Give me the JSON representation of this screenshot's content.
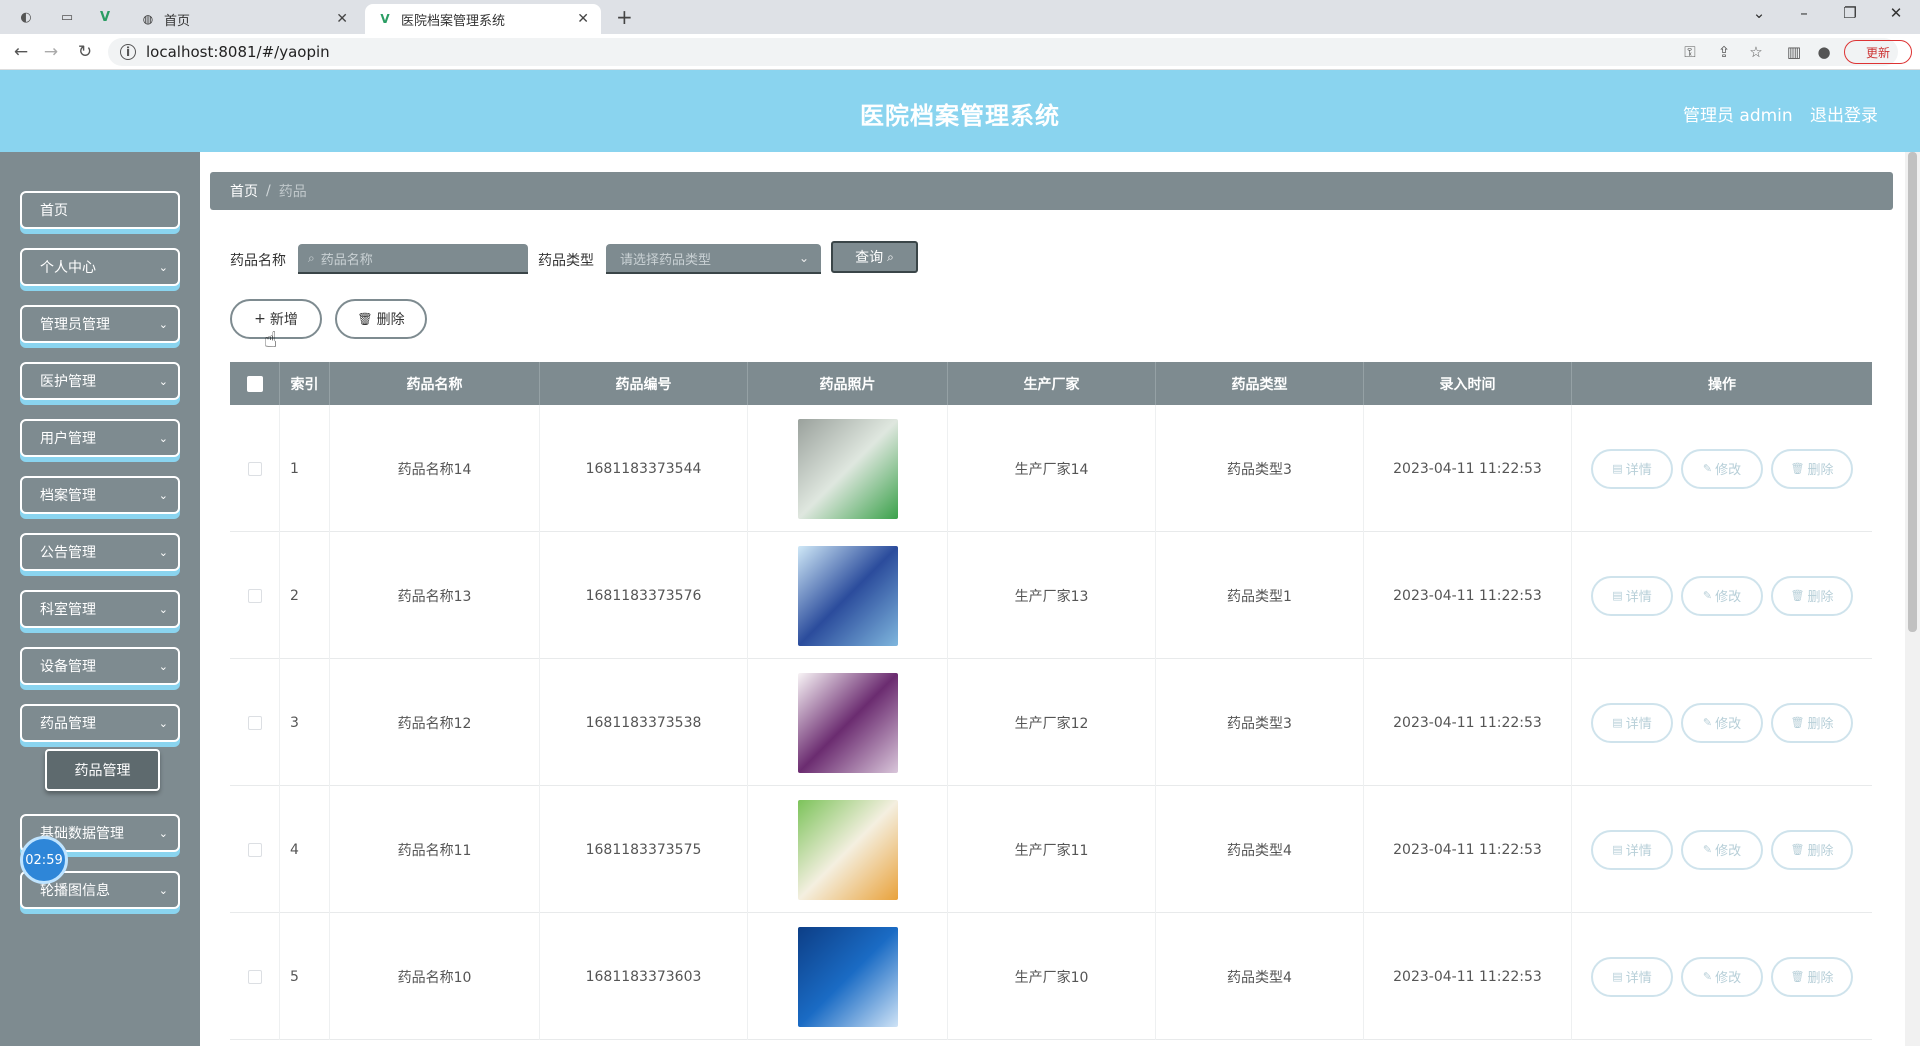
{
  "browser": {
    "tabs": [
      {
        "title": "首页",
        "active": false
      },
      {
        "title": "医院档案管理系统",
        "active": true
      }
    ],
    "url": "localhost:8081/#/yaopin",
    "update_label": "更新"
  },
  "header": {
    "title": "医院档案管理系统",
    "user": "管理员 admin",
    "logout": "退出登录"
  },
  "sidebar": {
    "items": [
      {
        "label": "首页",
        "has_children": false
      },
      {
        "label": "个人中心",
        "has_children": true
      },
      {
        "label": "管理员管理",
        "has_children": true
      },
      {
        "label": "医护管理",
        "has_children": true
      },
      {
        "label": "用户管理",
        "has_children": true
      },
      {
        "label": "档案管理",
        "has_children": true
      },
      {
        "label": "公告管理",
        "has_children": true
      },
      {
        "label": "科室管理",
        "has_children": true
      },
      {
        "label": "设备管理",
        "has_children": true
      },
      {
        "label": "药品管理",
        "has_children": true
      },
      {
        "label": "基础数据管理",
        "has_children": true
      },
      {
        "label": "轮播图信息",
        "has_children": true
      }
    ],
    "active_submenu": "药品管理",
    "clock": "02:59"
  },
  "breadcrumb": {
    "home": "首页",
    "separator": "/",
    "current": "药品"
  },
  "filters": {
    "name_label": "药品名称",
    "name_placeholder": "药品名称",
    "type_label": "药品类型",
    "type_placeholder": "请选择药品类型",
    "query_button": "查询"
  },
  "actions": {
    "add": "新增",
    "delete": "删除"
  },
  "table": {
    "columns": [
      "索引",
      "药品名称",
      "药品编号",
      "药品照片",
      "生产厂家",
      "药品类型",
      "录入时间",
      "操作"
    ],
    "rows": [
      {
        "index": "1",
        "name": "药品名称14",
        "code": "1681183373544",
        "maker": "生产厂家14",
        "type": "药品类型3",
        "time": "2023-04-11 11:22:53",
        "photo_colors": [
          "#9aa19c",
          "#dfe7df",
          "#3aa14a"
        ]
      },
      {
        "index": "2",
        "name": "药品名称13",
        "code": "1681183373576",
        "maker": "生产厂家13",
        "type": "药品类型1",
        "time": "2023-04-11 11:22:53",
        "photo_colors": [
          "#cfe8f7",
          "#2b4c9c",
          "#7fb6dd"
        ]
      },
      {
        "index": "3",
        "name": "药品名称12",
        "code": "1681183373538",
        "maker": "生产厂家12",
        "type": "药品类型3",
        "time": "2023-04-11 11:22:53",
        "photo_colors": [
          "#f8f4f6",
          "#6b2c70",
          "#d9c6da"
        ]
      },
      {
        "index": "4",
        "name": "药品名称11",
        "code": "1681183373575",
        "maker": "生产厂家11",
        "type": "药品类型4",
        "time": "2023-04-11 11:22:53",
        "photo_colors": [
          "#7cc35a",
          "#f4efe0",
          "#e9a23b"
        ]
      },
      {
        "index": "5",
        "name": "药品名称10",
        "code": "1681183373603",
        "maker": "生产厂家10",
        "type": "药品类型4",
        "time": "2023-04-11 11:22:53",
        "photo_colors": [
          "#0d3e86",
          "#1a6bc4",
          "#cfe3f6"
        ]
      }
    ],
    "row_actions": {
      "detail": "详情",
      "edit": "修改",
      "delete": "删除"
    }
  }
}
